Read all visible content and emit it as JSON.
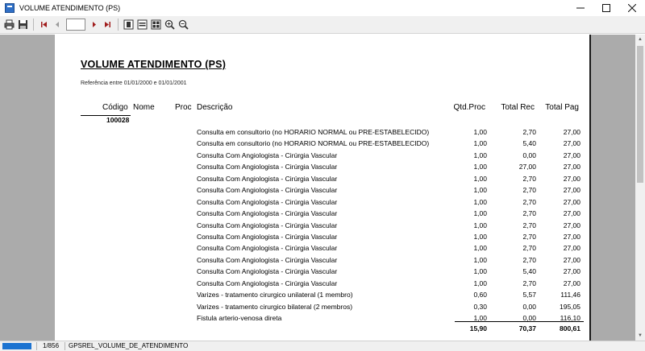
{
  "window": {
    "title": "VOLUME ATENDIMENTO (PS)"
  },
  "toolbar": {
    "page_value": ""
  },
  "report": {
    "title": "VOLUME ATENDIMENTO (PS)",
    "reference": "Referência entre 01/01/2000 e 01/01/2001",
    "columns": {
      "codigo": "Código",
      "nome": "Nome",
      "proc": "Proc",
      "descricao": "Descrição",
      "qtd_proc": "Qtd.Proc",
      "total_rec": "Total Rec",
      "total_pag": "Total Pag"
    },
    "group_code": "100028",
    "rows": [
      {
        "desc": "Consulta em consultorio (no HORARIO NORMAL ou PRE-ESTABELECIDO)",
        "qtd": "1,00",
        "rec": "2,70",
        "pag": "27,00"
      },
      {
        "desc": "Consulta em consultorio (no HORARIO NORMAL ou PRE-ESTABELECIDO)",
        "qtd": "1,00",
        "rec": "5,40",
        "pag": "27,00"
      },
      {
        "desc": "Consulta Com Angiologista - Cirúrgia Vascular",
        "qtd": "1,00",
        "rec": "0,00",
        "pag": "27,00"
      },
      {
        "desc": "Consulta Com Angiologista - Cirúrgia Vascular",
        "qtd": "1,00",
        "rec": "27,00",
        "pag": "27,00"
      },
      {
        "desc": "Consulta Com Angiologista - Cirúrgia Vascular",
        "qtd": "1,00",
        "rec": "2,70",
        "pag": "27,00"
      },
      {
        "desc": "Consulta Com Angiologista - Cirúrgia Vascular",
        "qtd": "1,00",
        "rec": "2,70",
        "pag": "27,00"
      },
      {
        "desc": "Consulta Com Angiologista - Cirúrgia Vascular",
        "qtd": "1,00",
        "rec": "2,70",
        "pag": "27,00"
      },
      {
        "desc": "Consulta Com Angiologista - Cirúrgia Vascular",
        "qtd": "1,00",
        "rec": "2,70",
        "pag": "27,00"
      },
      {
        "desc": "Consulta Com Angiologista - Cirúrgia Vascular",
        "qtd": "1,00",
        "rec": "2,70",
        "pag": "27,00"
      },
      {
        "desc": "Consulta Com Angiologista - Cirúrgia Vascular",
        "qtd": "1,00",
        "rec": "2,70",
        "pag": "27,00"
      },
      {
        "desc": "Consulta Com Angiologista - Cirúrgia Vascular",
        "qtd": "1,00",
        "rec": "2,70",
        "pag": "27,00"
      },
      {
        "desc": "Consulta Com Angiologista - Cirúrgia Vascular",
        "qtd": "1,00",
        "rec": "2,70",
        "pag": "27,00"
      },
      {
        "desc": "Consulta Com Angiologista - Cirúrgia Vascular",
        "qtd": "1,00",
        "rec": "5,40",
        "pag": "27,00"
      },
      {
        "desc": "Consulta Com Angiologista - Cirúrgia Vascular",
        "qtd": "1,00",
        "rec": "2,70",
        "pag": "27,00"
      },
      {
        "desc": "Varizes - tratamento cirurgico unilateral  (1 membro)",
        "qtd": "0,60",
        "rec": "5,57",
        "pag": "111,46"
      },
      {
        "desc": "Varizes - tratamento cirurgico bilateral  (2 membros)",
        "qtd": "0,30",
        "rec": "0,00",
        "pag": "195,05"
      },
      {
        "desc": "Fistula arterio-venosa direta",
        "qtd": "1,00",
        "rec": "0,00",
        "pag": "116,10"
      }
    ],
    "totals": {
      "qtd": "15,90",
      "rec": "70,37",
      "pag": "800,61"
    }
  },
  "status": {
    "pages": "1/856",
    "report_name": "GPSREL_VOLUME_DE_ATENDIMENTO"
  }
}
